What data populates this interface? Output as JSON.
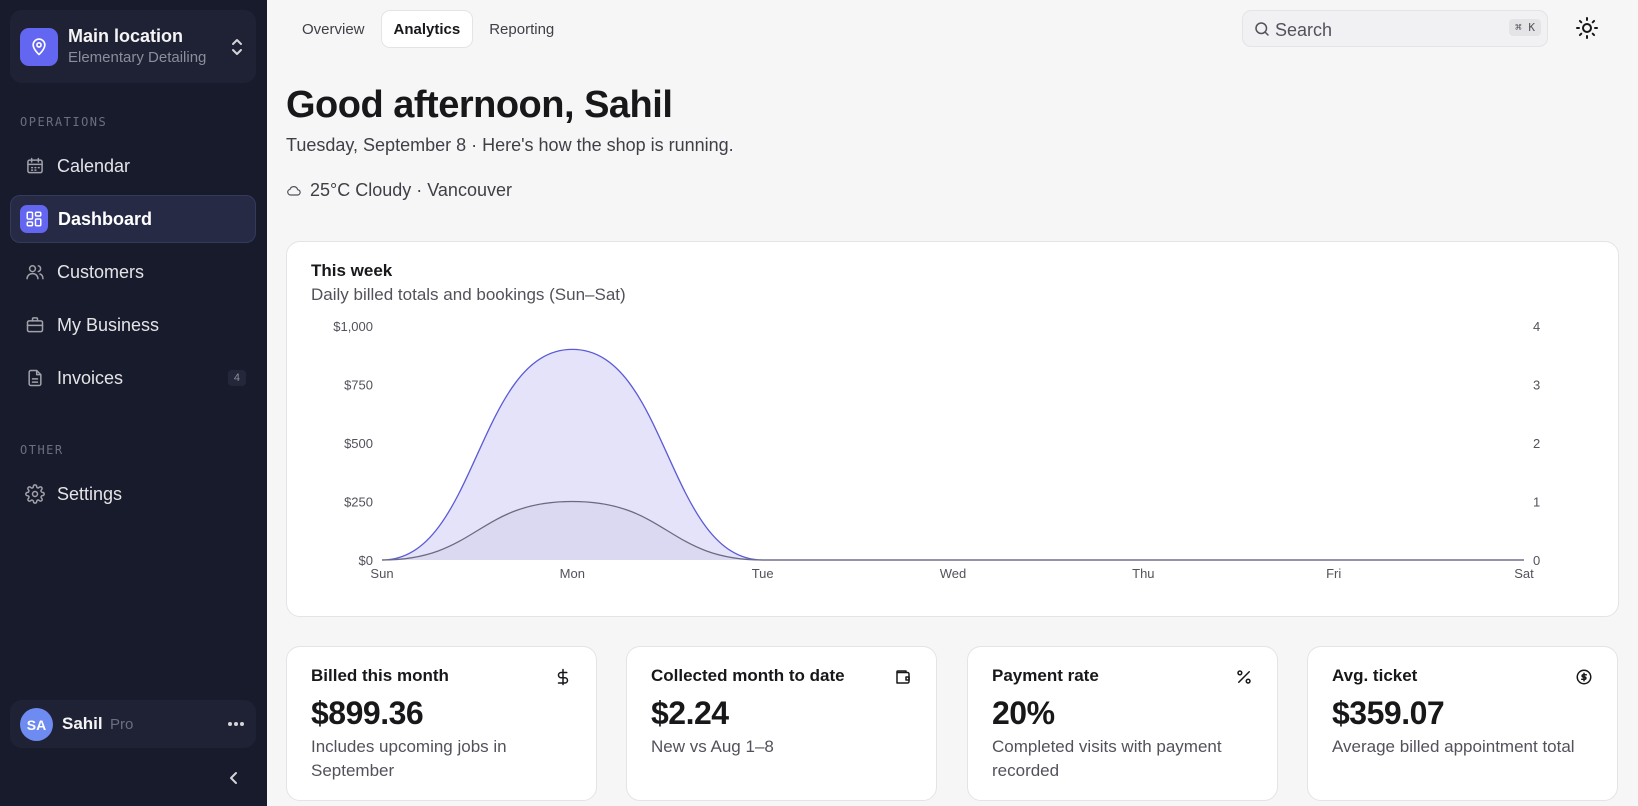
{
  "sidebar": {
    "location": {
      "title": "Main location",
      "subtitle": "Elementary Detailing"
    },
    "sections": {
      "operations": "OPERATIONS",
      "other": "OTHER"
    },
    "items": [
      {
        "label": "Calendar",
        "icon": "calendar-icon"
      },
      {
        "label": "Dashboard",
        "icon": "dashboard-icon",
        "active": true
      },
      {
        "label": "Customers",
        "icon": "users-icon"
      },
      {
        "label": "My Business",
        "icon": "briefcase-icon"
      },
      {
        "label": "Invoices",
        "icon": "invoice-icon",
        "badge": "4"
      },
      {
        "label": "Settings",
        "icon": "gear-icon"
      }
    ],
    "user": {
      "initials": "SA",
      "name": "Sahil",
      "plan": "Pro"
    }
  },
  "topbar": {
    "tabs": [
      "Overview",
      "Analytics",
      "Reporting"
    ],
    "active_tab": "Analytics",
    "search": {
      "placeholder": "Search",
      "shortcut": "⌘ K"
    }
  },
  "header": {
    "greeting": "Good afternoon, Sahil",
    "subline": "Tuesday, September 8 · Here's how the shop is running.",
    "weather": "25°C Cloudy · Vancouver"
  },
  "chart_card": {
    "title": "This week",
    "subtitle": "Daily billed totals and bookings (Sun–Sat)"
  },
  "chart_data": {
    "type": "area",
    "categories": [
      "Sun",
      "Mon",
      "Tue",
      "Wed",
      "Thu",
      "Fri",
      "Sat"
    ],
    "y_left": {
      "ticks": [
        "$0",
        "$250",
        "$500",
        "$750",
        "$1,000"
      ],
      "min": 0,
      "max": 1000
    },
    "y_right": {
      "ticks": [
        "0",
        "1",
        "2",
        "3",
        "4"
      ],
      "min": 0,
      "max": 4
    },
    "grid": false,
    "series": [
      {
        "axis": "left",
        "values": [
          0,
          900,
          0,
          0,
          0,
          0,
          0
        ],
        "color": "#5b5bd6",
        "fill": "#e2e0f9"
      },
      {
        "axis": "right",
        "values": [
          0,
          1,
          0,
          0,
          0,
          0,
          0
        ],
        "color": "#6b6b80",
        "fill": "#d6d5ee"
      }
    ]
  },
  "stats": [
    {
      "title": "Billed this month",
      "icon": "dollar-icon",
      "value": "$899.36",
      "desc": "Includes upcoming jobs in September"
    },
    {
      "title": "Collected month to date",
      "icon": "wallet-icon",
      "value": "$2.24",
      "desc": "New vs Aug 1–8"
    },
    {
      "title": "Payment rate",
      "icon": "percent-icon",
      "value": "20%",
      "desc": "Completed visits with payment recorded"
    },
    {
      "title": "Avg. ticket",
      "icon": "coin-icon",
      "value": "$359.07",
      "desc": "Average billed appointment total"
    }
  ]
}
